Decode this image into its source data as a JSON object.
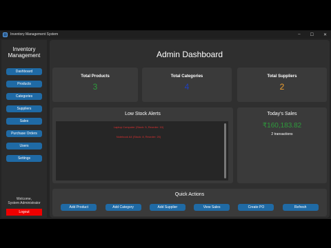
{
  "window": {
    "title": "Inventory Management System",
    "controls": [
      "–",
      "☐",
      "✕"
    ]
  },
  "sidebar": {
    "brand": [
      "Inventory",
      "Management"
    ],
    "items": [
      "Dashboard",
      "Products",
      "Categories",
      "Suppliers",
      "Sales",
      "Purchase Orders",
      "Users",
      "Settings"
    ],
    "welcome": [
      "Welcome,",
      "System Administrator"
    ],
    "logout": "Logout"
  },
  "main": {
    "title": "Admin Dashboard",
    "stats": [
      {
        "label": "Total Products",
        "value": "3",
        "color": "#2e9a3c"
      },
      {
        "label": "Total Categories",
        "value": "4",
        "color": "#1f3fbf"
      },
      {
        "label": "Total Suppliers",
        "value": "2",
        "color": "#f0a030"
      }
    ],
    "low_stock": {
      "title": "Low Stock Alerts",
      "items": [
        "Laptop Computer (Stock: 5, Reorder: 10)",
        "Notebook A4 (Stock: 8, Reorder: 20)"
      ]
    },
    "sales": {
      "title": "Today's Sales",
      "amount": "₹160,183.82",
      "transactions": "2 transactions"
    },
    "quick_actions": {
      "title": "Quick Actions",
      "buttons": [
        "Add Product",
        "Add Category",
        "Add Supplier",
        "View Sales",
        "Create PO",
        "Refresh"
      ]
    }
  },
  "colors": {
    "accent": "#1f6aa5",
    "danger": "#e00000",
    "alert_text": "#e03030"
  }
}
